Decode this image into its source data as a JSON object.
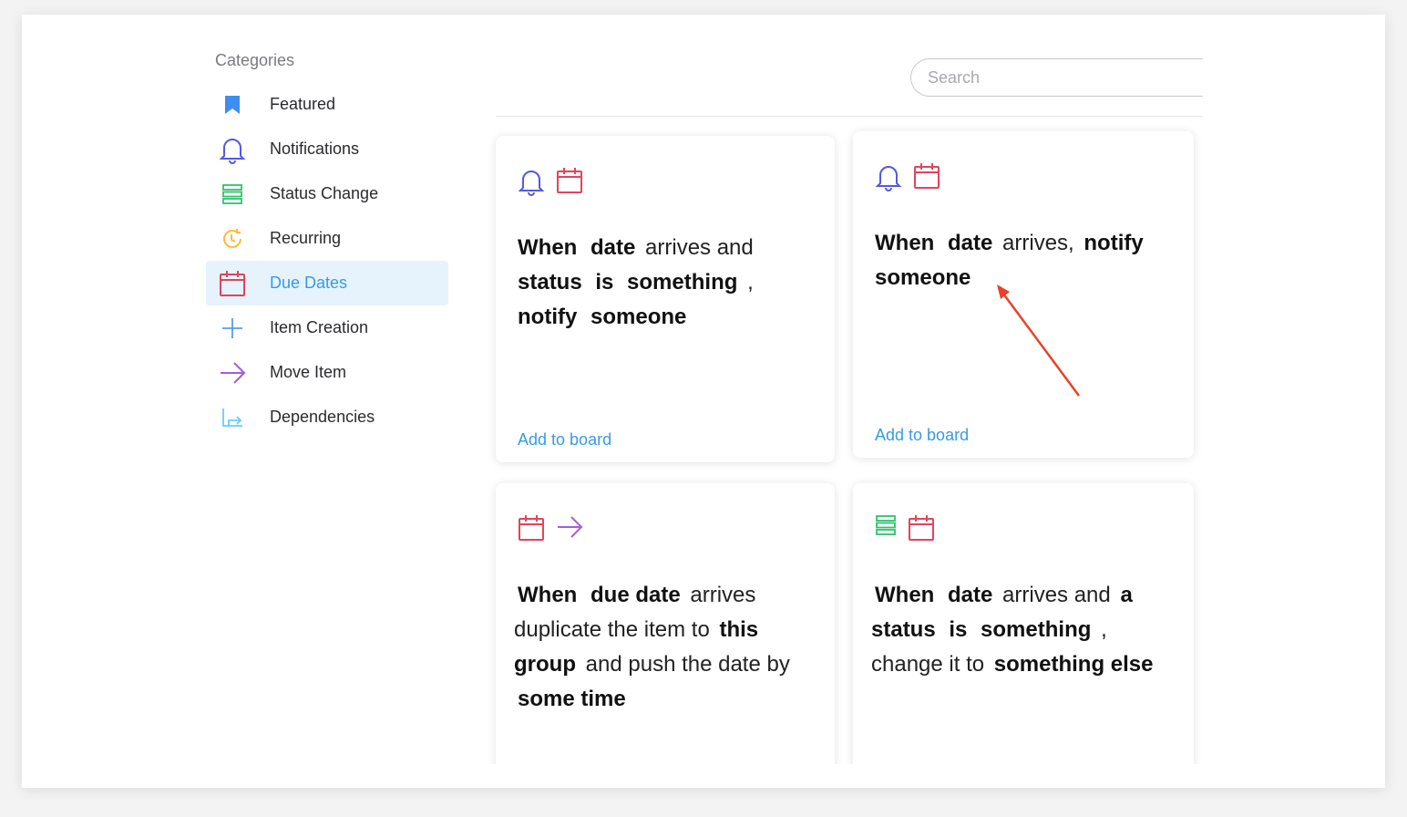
{
  "sidebar": {
    "heading": "Categories",
    "items": [
      {
        "label": "Featured",
        "icon": "bookmark-icon",
        "color": "#3d8ef0"
      },
      {
        "label": "Notifications",
        "icon": "bell-icon",
        "color": "#5559df"
      },
      {
        "label": "Status Change",
        "icon": "status-list-icon",
        "color": "#2fc26d"
      },
      {
        "label": "Recurring",
        "icon": "recurring-clock-icon",
        "color": "#fdbc3a"
      },
      {
        "label": "Due Dates",
        "icon": "calendar-icon",
        "color": "#e2445c",
        "active": true
      },
      {
        "label": "Item Creation",
        "icon": "plus-icon",
        "color": "#579bfc"
      },
      {
        "label": "Move Item",
        "icon": "arrow-right-icon",
        "color": "#a25ddc"
      },
      {
        "label": "Dependencies",
        "icon": "dependency-icon",
        "color": "#66ccff"
      }
    ]
  },
  "search": {
    "placeholder": "Search",
    "value": ""
  },
  "cards": [
    {
      "icons": [
        "bell-icon",
        "calendar-icon"
      ],
      "segments": [
        {
          "t": "When",
          "b": true
        },
        {
          "t": "date",
          "b": true
        },
        {
          "t": "arrives and",
          "b": false
        },
        {
          "t": "status",
          "b": true
        },
        {
          "t": "is",
          "b": true
        },
        {
          "t": "something",
          "b": true
        },
        {
          "t": ",",
          "b": false
        },
        {
          "t": "notify",
          "b": true
        },
        {
          "t": "someone",
          "b": true
        }
      ],
      "link": "Add to board"
    },
    {
      "icons": [
        "bell-icon",
        "calendar-icon"
      ],
      "segments": [
        {
          "t": "When",
          "b": true
        },
        {
          "t": "date",
          "b": true
        },
        {
          "t": "arrives,",
          "b": false
        },
        {
          "t": "notify",
          "b": true
        },
        {
          "t": "someone",
          "b": true
        }
      ],
      "link": "Add to board"
    },
    {
      "icons": [
        "calendar-icon",
        "arrow-right-icon"
      ],
      "segments": [
        {
          "t": "When",
          "b": true
        },
        {
          "t": "due date",
          "b": true
        },
        {
          "t": "arrives duplicate the item to",
          "b": false
        },
        {
          "t": "this group",
          "b": true
        },
        {
          "t": "and push the date by",
          "b": false
        },
        {
          "t": "some time",
          "b": true
        }
      ],
      "link": ""
    },
    {
      "icons": [
        "status-list-icon",
        "calendar-icon"
      ],
      "segments": [
        {
          "t": "When",
          "b": true
        },
        {
          "t": "date",
          "b": true
        },
        {
          "t": "arrives and",
          "b": false
        },
        {
          "t": "a status",
          "b": true
        },
        {
          "t": "is",
          "b": true
        },
        {
          "t": "something",
          "b": true
        },
        {
          "t": ", change it to",
          "b": false
        },
        {
          "t": "something else",
          "b": true
        }
      ],
      "link": ""
    }
  ],
  "colors": {
    "accent": "#389be0",
    "active_bg": "#e6f3fd",
    "annotation_arrow": "#e8412c"
  }
}
